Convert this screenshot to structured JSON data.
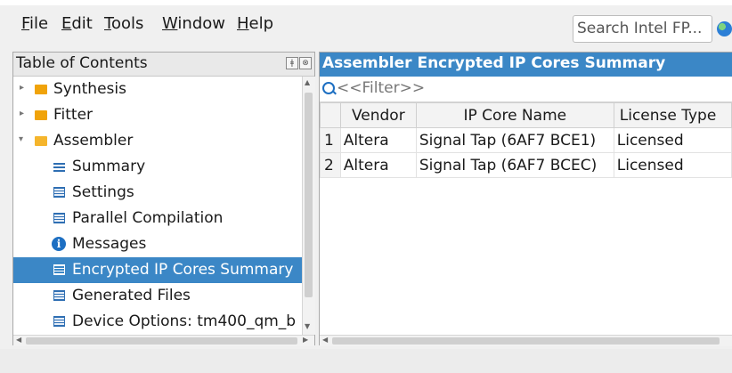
{
  "menu": {
    "items": [
      {
        "key": "F",
        "rest": "ile"
      },
      {
        "key": "E",
        "rest": "dit"
      },
      {
        "key": "T",
        "rest": "ools"
      },
      {
        "key": "W",
        "rest": "indow"
      },
      {
        "key": "H",
        "rest": "elp"
      }
    ]
  },
  "search": {
    "placeholder": "Search Intel FP..."
  },
  "toc": {
    "title": "Table of Contents",
    "items": [
      {
        "label": "Synthesis",
        "icon": "folder-icon",
        "expander": "collapsed"
      },
      {
        "label": "Fitter",
        "icon": "folder-icon",
        "expander": "collapsed"
      },
      {
        "label": "Assembler",
        "icon": "folder-open-icon",
        "expander": "expanded"
      },
      {
        "label": "Summary",
        "icon": "list-icon"
      },
      {
        "label": "Settings",
        "icon": "table-icon"
      },
      {
        "label": "Parallel Compilation",
        "icon": "table-icon"
      },
      {
        "label": "Messages",
        "icon": "info-icon"
      },
      {
        "label": "Encrypted IP Cores Summary",
        "icon": "table-icon",
        "selected": true
      },
      {
        "label": "Generated Files",
        "icon": "table-icon"
      },
      {
        "label": "Device Options: tm400_qm_b",
        "icon": "table-icon"
      }
    ]
  },
  "report": {
    "title": "Assembler Encrypted IP Cores Summary",
    "filter_placeholder": "<<Filter>>",
    "columns": [
      "",
      "Vendor",
      "IP Core Name",
      "License Type"
    ],
    "rows": [
      [
        "1",
        "Altera",
        "Signal Tap (6AF7 BCE1)",
        "Licensed"
      ],
      [
        "2",
        "Altera",
        "Signal Tap (6AF7 BCEC)",
        "Licensed"
      ]
    ]
  },
  "colors": {
    "accent": "#3b87c6",
    "folder": "#f0a30a",
    "icon_blue": "#1d6fc2"
  }
}
